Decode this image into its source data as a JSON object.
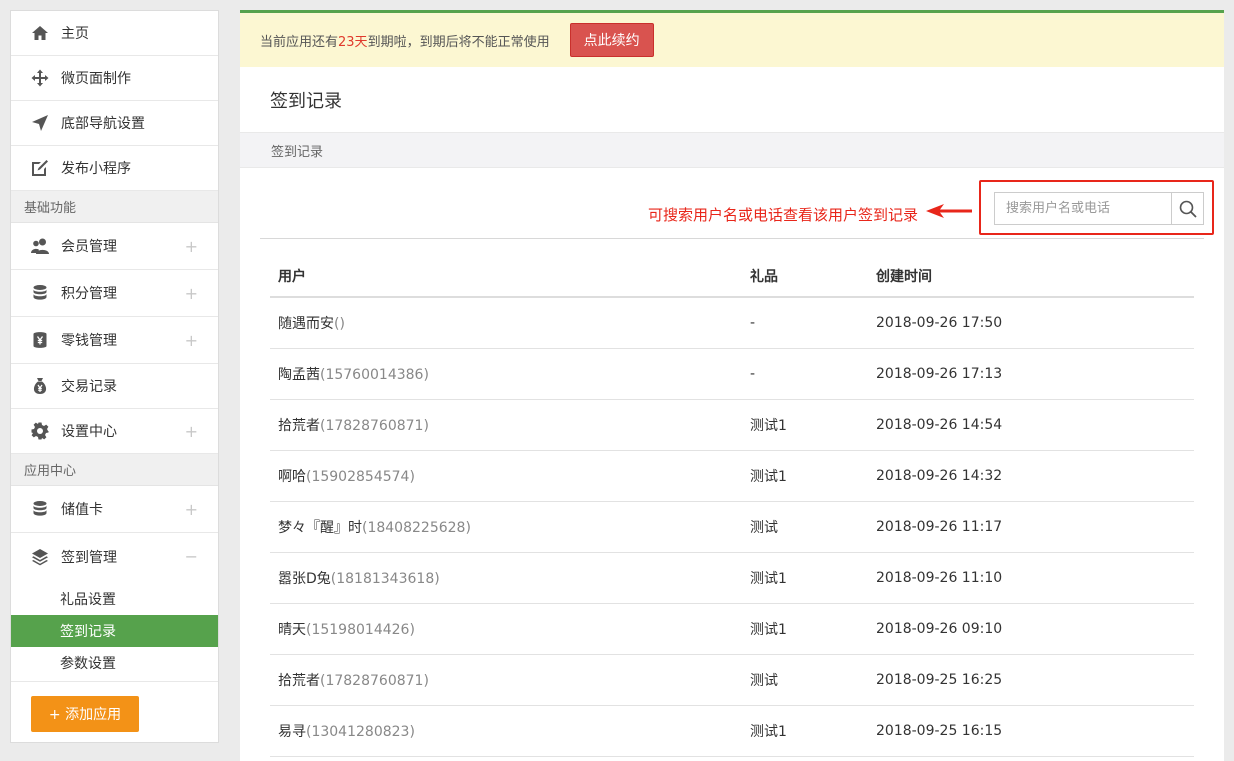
{
  "sidebar": {
    "top_items": [
      {
        "label": "主页",
        "icon": "home-icon"
      },
      {
        "label": "微页面制作",
        "icon": "move-icon"
      },
      {
        "label": "底部导航设置",
        "icon": "navigation-icon"
      },
      {
        "label": "发布小程序",
        "icon": "edit-icon"
      }
    ],
    "section_basic": "基础功能",
    "basic_items": [
      {
        "label": "会员管理",
        "icon": "users-icon",
        "toggle": "+"
      },
      {
        "label": "积分管理",
        "icon": "database-icon",
        "toggle": "+"
      },
      {
        "label": "零钱管理",
        "icon": "yen-cylinder-icon",
        "toggle": "+"
      },
      {
        "label": "交易记录",
        "icon": "money-bag-icon"
      },
      {
        "label": "设置中心",
        "icon": "gear-icon",
        "toggle": "+"
      }
    ],
    "section_apps": "应用中心",
    "app_items": [
      {
        "label": "储值卡",
        "icon": "database-icon",
        "toggle": "+"
      },
      {
        "label": "签到管理",
        "icon": "layers-icon",
        "toggle": "−"
      }
    ],
    "sub_items": [
      {
        "label": "礼品设置",
        "active": false
      },
      {
        "label": "签到记录",
        "active": true
      },
      {
        "label": "参数设置",
        "active": false
      }
    ],
    "add_button": "+ 添加应用"
  },
  "notice": {
    "text_before": "当前应用还有",
    "days": "23天",
    "text_after": "到期啦，到期后将不能正常使用",
    "button": "点此续约"
  },
  "page_title": "签到记录",
  "tab": "签到记录",
  "annotation": "可搜索用户名或电话查看该用户签到记录",
  "search": {
    "placeholder": "搜索用户名或电话",
    "value": ""
  },
  "table": {
    "headers": [
      "用户",
      "礼品",
      "创建时间"
    ],
    "rows": [
      {
        "name": "随遇而安",
        "phone": "()",
        "gift": "-",
        "time": "2018-09-26 17:50"
      },
      {
        "name": "陶孟茜",
        "phone": "(15760014386)",
        "gift": "-",
        "time": "2018-09-26 17:13"
      },
      {
        "name": "拾荒者",
        "phone": "(17828760871)",
        "gift": "测试1",
        "time": "2018-09-26 14:54"
      },
      {
        "name": "啊哈",
        "phone": "(15902854574)",
        "gift": "测试1",
        "time": "2018-09-26 14:32"
      },
      {
        "name": "梦々『醒』时",
        "phone": "(18408225628)",
        "gift": "测试",
        "time": "2018-09-26 11:17"
      },
      {
        "name": "嚣张D兔",
        "phone": "(18181343618)",
        "gift": "测试1",
        "time": "2018-09-26 11:10"
      },
      {
        "name": "晴天",
        "phone": "(15198014426)",
        "gift": "测试1",
        "time": "2018-09-26 09:10"
      },
      {
        "name": "拾荒者",
        "phone": "(17828760871)",
        "gift": "测试",
        "time": "2018-09-25 16:25"
      },
      {
        "name": "易寻",
        "phone": "(13041280823)",
        "gift": "测试1",
        "time": "2018-09-25 16:15"
      }
    ]
  },
  "colors": {
    "accent_green": "#56a24c",
    "notice_bg": "#fcf7d2",
    "danger_red": "#d9534f",
    "annotation_red": "#e8261a",
    "add_orange": "#f39217"
  }
}
